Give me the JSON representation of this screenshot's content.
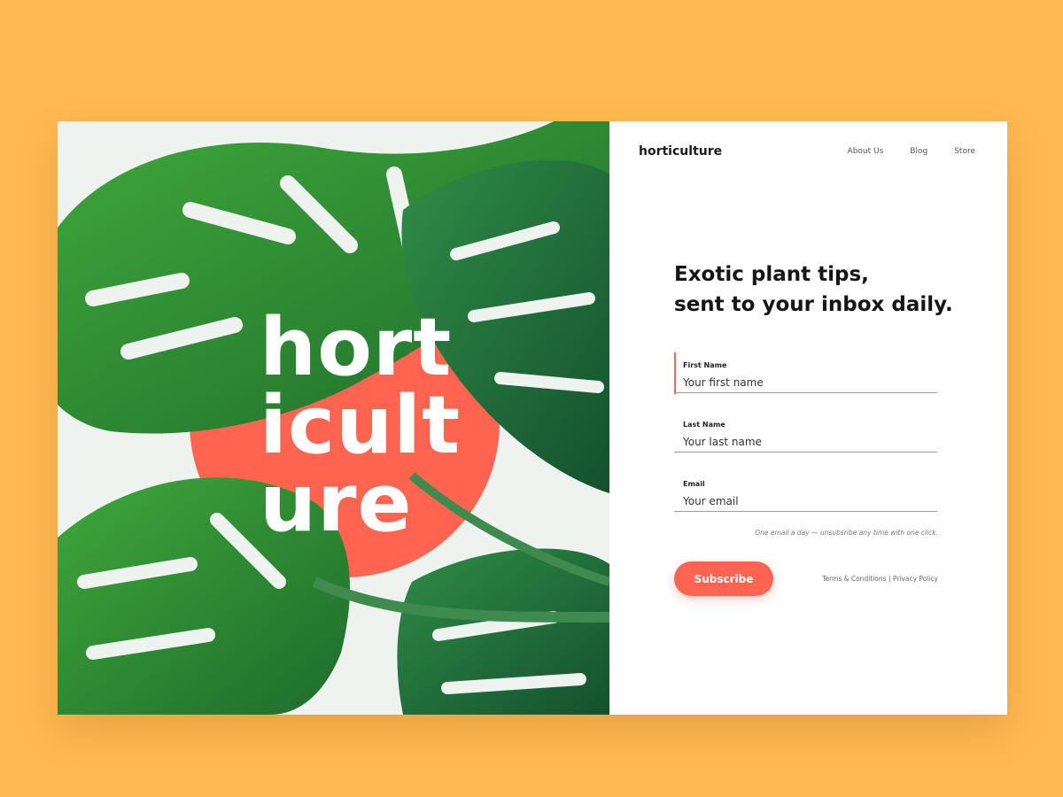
{
  "brand": {
    "name": "horticulture"
  },
  "nav": {
    "items": [
      {
        "label": "About Us"
      },
      {
        "label": "Blog"
      },
      {
        "label": "Store"
      }
    ]
  },
  "hero": {
    "lines": [
      "hort",
      "icult",
      "ure"
    ],
    "accent_color": "#FF6450"
  },
  "form": {
    "headline_line1": "Exotic plant tips,",
    "headline_line2": "sent to your inbox daily.",
    "first_name": {
      "label": "First Name",
      "placeholder": "Your first name",
      "value": ""
    },
    "last_name": {
      "label": "Last Name",
      "placeholder": "Your last name",
      "value": ""
    },
    "email": {
      "label": "Email",
      "placeholder": "Your email",
      "value": ""
    },
    "note": "One email a day — unsubsribe any time with one click.",
    "subscribe_label": "Subscribe",
    "terms_label": "Terms & Conditions",
    "separator": "|",
    "privacy_label": "Privacy Policy"
  },
  "colors": {
    "background": "#FFB952",
    "accent": "#FF6450",
    "leaf": "#2E7D32"
  }
}
